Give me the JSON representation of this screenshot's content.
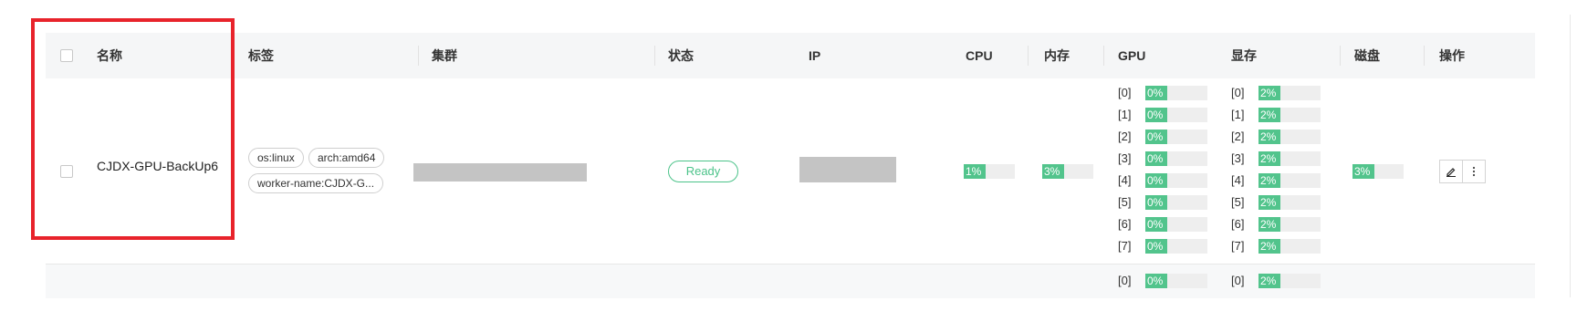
{
  "columns": {
    "name": "名称",
    "labels": "标签",
    "cluster": "集群",
    "status": "状态",
    "ip": "IP",
    "cpu": "CPU",
    "memory": "内存",
    "gpu": "GPU",
    "vram": "显存",
    "disk": "磁盘",
    "actions": "操作"
  },
  "row": {
    "name": "CJDX-GPU-BackUp6",
    "tags": [
      "os:linux",
      "arch:amd64",
      "worker-name:CJDX-G..."
    ],
    "status": "Ready",
    "cpu": {
      "label": "1%",
      "value": 1
    },
    "memory": {
      "label": "3%",
      "value": 3
    },
    "disk": {
      "label": "3%",
      "value": 3
    },
    "gpus": [
      {
        "index": "[0]",
        "label": "0%",
        "value": 0
      },
      {
        "index": "[1]",
        "label": "0%",
        "value": 0
      },
      {
        "index": "[2]",
        "label": "0%",
        "value": 0
      },
      {
        "index": "[3]",
        "label": "0%",
        "value": 0
      },
      {
        "index": "[4]",
        "label": "0%",
        "value": 0
      },
      {
        "index": "[5]",
        "label": "0%",
        "value": 0
      },
      {
        "index": "[6]",
        "label": "0%",
        "value": 0
      },
      {
        "index": "[7]",
        "label": "0%",
        "value": 0
      }
    ],
    "vram": [
      {
        "index": "[0]",
        "label": "2%",
        "value": 2
      },
      {
        "index": "[1]",
        "label": "2%",
        "value": 2
      },
      {
        "index": "[2]",
        "label": "2%",
        "value": 2
      },
      {
        "index": "[3]",
        "label": "2%",
        "value": 2
      },
      {
        "index": "[4]",
        "label": "2%",
        "value": 2
      },
      {
        "index": "[5]",
        "label": "2%",
        "value": 2
      },
      {
        "index": "[6]",
        "label": "2%",
        "value": 2
      },
      {
        "index": "[7]",
        "label": "2%",
        "value": 2
      }
    ]
  },
  "row2": {
    "gpu0": {
      "index": "[0]",
      "label": "0%",
      "value": 0
    },
    "vram0": {
      "index": "[0]",
      "label": "2%",
      "value": 2
    }
  },
  "icons": {
    "edit": "edit-icon",
    "more": "more-vertical-icon"
  },
  "colors": {
    "accent": "#52c48c",
    "status_ready": "#4cc38a",
    "highlight": "#e8232b"
  }
}
